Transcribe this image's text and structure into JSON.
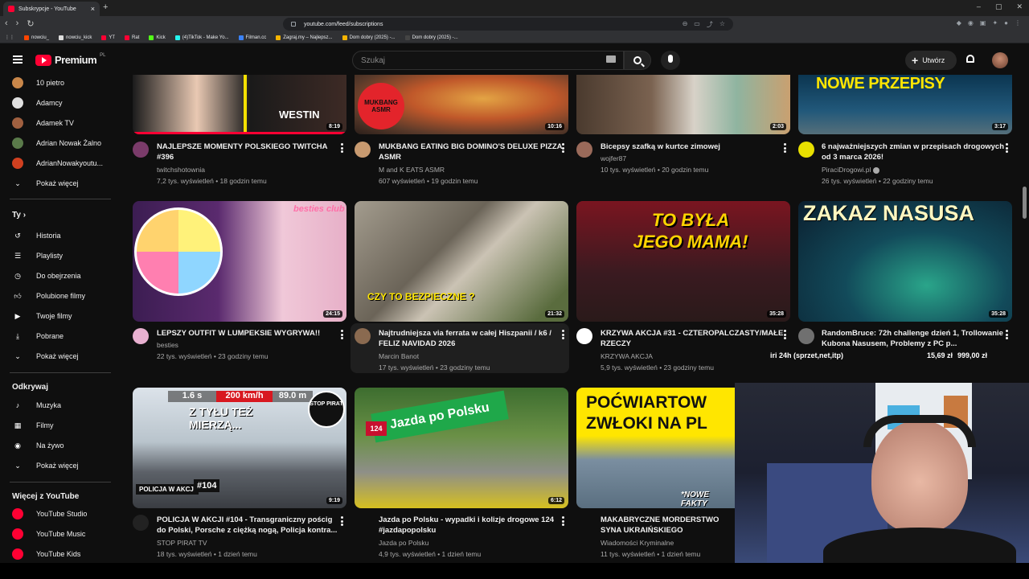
{
  "browser": {
    "tab_title": "Subskrypcje - YouTube",
    "url": "youtube.com/feed/subscriptions",
    "bookmarks": [
      {
        "label": "nowciu_",
        "color": "#ff4500"
      },
      {
        "label": "nowciu_kick",
        "color": "#dddddd"
      },
      {
        "label": "YT",
        "color": "#ff0033"
      },
      {
        "label": "Rat",
        "color": "#ff0033"
      },
      {
        "label": "Kick",
        "color": "#53fc18"
      },
      {
        "label": "(4)TikTok - Make Yo...",
        "color": "#25f4ee"
      },
      {
        "label": "Filman.cc",
        "color": "#3b82f6"
      },
      {
        "label": "Zagraj.my – Najlepsz...",
        "color": "#f5b400"
      },
      {
        "label": "Dom dobry (2025) -...",
        "color": "#f5b400"
      },
      {
        "label": "Dom dobry (2025) -...",
        "color": "#444444"
      }
    ]
  },
  "masthead": {
    "logo_text": "Premium",
    "country": "PL",
    "search_placeholder": "Szukaj",
    "create_label": "Utwórz"
  },
  "sidebar": {
    "subscriptions": [
      {
        "label": "10 pietro",
        "color": "#c9874a"
      },
      {
        "label": "Adamcy",
        "color": "#e0e0e0"
      },
      {
        "label": "Adamek TV",
        "color": "#a06040"
      },
      {
        "label": "Adrian Nowak Żalno",
        "color": "#5a7a4a"
      },
      {
        "label": "AdrianNowakyoutu...",
        "color": "#d04020"
      }
    ],
    "show_more": "Pokaż więcej",
    "you_header": "Ty",
    "you_items": [
      {
        "label": "Historia",
        "icon": "history-icon"
      },
      {
        "label": "Playlisty",
        "icon": "playlists-icon"
      },
      {
        "label": "Do obejrzenia",
        "icon": "watch-later-icon"
      },
      {
        "label": "Polubione filmy",
        "icon": "liked-icon"
      },
      {
        "label": "Twoje filmy",
        "icon": "your-videos-icon"
      },
      {
        "label": "Pobrane",
        "icon": "downloads-icon"
      }
    ],
    "show_more_2": "Pokaż więcej",
    "explore_header": "Odkrywaj",
    "explore_items": [
      {
        "label": "Muzyka",
        "icon": "music-icon"
      },
      {
        "label": "Filmy",
        "icon": "movies-icon"
      },
      {
        "label": "Na żywo",
        "icon": "live-icon"
      }
    ],
    "show_more_3": "Pokaż więcej",
    "more_header": "Więcej z YouTube",
    "more_items": [
      {
        "label": "YouTube Studio"
      },
      {
        "label": "YouTube Music"
      },
      {
        "label": "YouTube Kids"
      }
    ]
  },
  "videos": [
    {
      "title": "NAJLEPSZE MOMENTY POLSKIEGO TWITCHA #396",
      "channel": "twitchshotownia",
      "meta": "7,2 tys. wyświetleń • 18 godzin temu",
      "duration": "8:19",
      "thumb_text": "WESTIN",
      "avatar_color": "#7a3b6a"
    },
    {
      "title": "MUKBANG EATING BIG DOMINO'S DELUXE PIZZA ASMR",
      "channel": "M and K EATS ASMR",
      "meta": "607 wyświetleń • 19 godzin temu",
      "duration": "10:16",
      "thumb_text": "MUKBANG ASMR",
      "avatar_color": "#c89a70"
    },
    {
      "title": "Bicepsy szafką w kurtce zimowej",
      "channel": "wojfer87",
      "meta": "10 tys. wyświetleń • 20 godzin temu",
      "duration": "2:03",
      "thumb_text": "",
      "avatar_color": "#9a6a5a"
    },
    {
      "title": "6 najważniejszych zmian w przepisach drogowych od 3 marca 2026!",
      "channel": "PiraciDrogowi.pl",
      "meta": "26 tys. wyświetleń • 22 godziny temu",
      "duration": "3:17",
      "thumb_text": "NOWE PRZEPISY",
      "avatar_color": "#e8e000"
    },
    {
      "title": "LEPSZY OUTFIT W LUMPEKSIE WYGRYWA!!",
      "channel": "besties",
      "meta": "22 tys. wyświetleń • 23 godziny temu",
      "duration": "24:15",
      "thumb_text": "besties club",
      "avatar_color": "#e8b0d0"
    },
    {
      "title": "Najtrudniejsza via ferrata w całej Hiszpanii  / k6 / FELIZ NAVIDAD 2026",
      "channel": "Marcin Banot",
      "meta": "17 tys. wyświetleń • 23 godziny temu",
      "duration": "21:32",
      "thumb_text": "CZY TO BEZPIECZNE ?",
      "avatar_color": "#8a6a50"
    },
    {
      "title": "KRZYWA AKCJA #31 - CZTEROPALCZASTY/MAŁE RZECZY",
      "channel": "KRZYWA AKCJA",
      "meta": "5,9 tys. wyświetleń • 23 godziny temu",
      "duration": "35:28",
      "thumb_text": "TO BYŁA JEGO MAMA!",
      "avatar_color": "#ffffff"
    },
    {
      "title": "RandomBruce: 72h challenge dzień 1, Trollowanie Kubona Nasusem, Problemy z PC p...",
      "channel": "",
      "meta": "",
      "duration": "35:28",
      "thumb_text": "ZAKAZ NASUSA",
      "avatar_color": "#707070"
    },
    {
      "title": "POLICJA W AKCJI #104 - Transgraniczny pościg do Polski, Porsche z ciężką nogą, Policja kontra...",
      "channel": "STOP PIRAT TV",
      "meta": "18 tys. wyświetleń • 1 dzień temu",
      "duration": "9:19",
      "thumb_text": "Z TYŁU TEŻ MIERZĄ...",
      "avatar_color": "#222"
    },
    {
      "title": "Jazda po Polsku - wypadki i kolizje drogowe 124 #jazdapopolsku",
      "channel": "Jazda po Polsku",
      "meta": "4,9 tys. wyświetleń • 1 dzień temu",
      "duration": "6:12",
      "thumb_text": "Jazda po Polsku",
      "avatar_color": "#222"
    },
    {
      "title": "MAKABRYCZNE MORDERSTWO SYNA UKRAIŃSKIEGO GANGSTERA!?",
      "channel": "Wiadomości Kryminalne",
      "meta": "11 tys. wyświetleń • 1 dzień temu",
      "duration": "",
      "thumb_text": "POĆWIARTOW ZWŁOKI NA PL",
      "avatar_color": "#222"
    }
  ],
  "speed_overlay": {
    "a": "1.6 s",
    "b": "200 km/h",
    "c": "89.0 m"
  },
  "badges": {
    "policja": "POLICJA W AKCJI",
    "num104": "#104",
    "num124": "124",
    "nowe_fakty": "*NOWE FAKTY",
    "stop_pirat": "STOP PIRAT"
  },
  "stream_overlay": {
    "label": "iri 24h (sprzet,net,itp)",
    "value1": "15,69 zł",
    "value2": "999,00 zł"
  }
}
